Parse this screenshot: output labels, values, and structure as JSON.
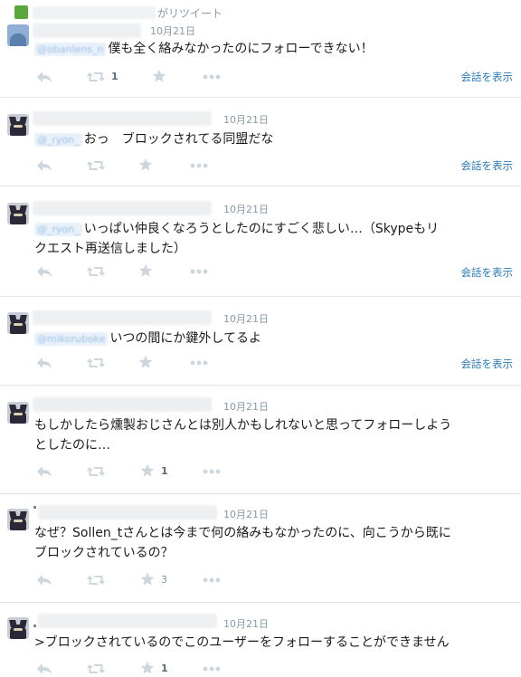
{
  "retweet_header": {
    "suffix": "がリツイート"
  },
  "conversation_label": "会話を表示",
  "tweets": [
    {
      "date": "10月21日",
      "mention": "@obanlens_n",
      "text": "僕も全く絡みなかったのにフォローできない！",
      "retweet_count": "1",
      "favorite_count": ""
    },
    {
      "date": "10月21日",
      "mention": "@_ryon_",
      "text": "おっ　ブロックされてる同盟だな",
      "retweet_count": "",
      "favorite_count": ""
    },
    {
      "date": "10月21日",
      "mention": "@_ryon_",
      "text_line1": "いっぱい仲良くなろうとしたのにすごく悲しい…（Skypeもリ",
      "text_line2": "クエスト再送信しました）",
      "retweet_count": "",
      "favorite_count": ""
    },
    {
      "date": "10月21日",
      "mention": "@mikoruboke",
      "text": "いつの間にか鍵外してるよ",
      "retweet_count": "",
      "favorite_count": ""
    },
    {
      "date": "10月21日",
      "text_line1": "もしかしたら燻製おじさんとは別人かもしれないと思ってフォローしよう",
      "text_line2": "としたのに…",
      "retweet_count": "",
      "favorite_count": "1"
    },
    {
      "date": "10月21日",
      "text_line1": "なぜ？Sollen_tさんとは今まで何の絡みもなかったのに、向こうから既に",
      "text_line2": "ブロックされているの？",
      "retweet_count": "",
      "favorite_count": "3"
    },
    {
      "date": "10月21日",
      "text": ">ブロックされているのでこのユーザーをフォローすることができません",
      "retweet_count": "",
      "favorite_count": "1"
    }
  ]
}
